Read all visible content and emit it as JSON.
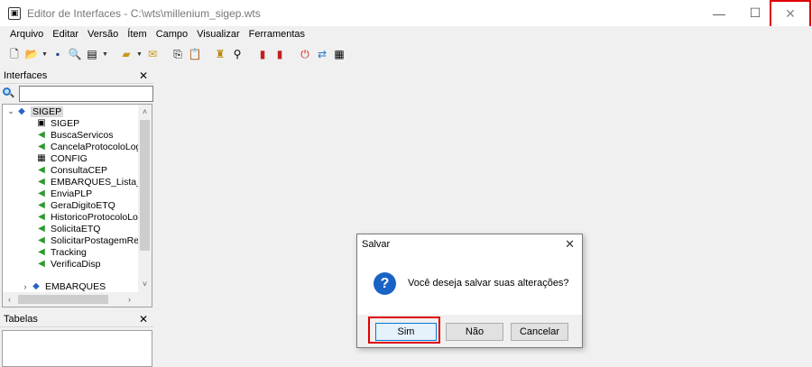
{
  "window": {
    "title": "Editor de Interfaces - C:\\wts\\millenium_sigep.wts",
    "app_icon": "form-window-icon",
    "minimize_icon": "—",
    "maximize_icon": "☐",
    "close_icon": "✕"
  },
  "menubar": [
    "Arquivo",
    "Editar",
    "Versão",
    "Ítem",
    "Campo",
    "Visualizar",
    "Ferramentas"
  ],
  "toolbar": {
    "icons": [
      "new-file-icon",
      "open-folder-icon",
      "save-icon",
      "find-icon",
      "preview-icon",
      "new-interface-icon",
      "open-interface-icon",
      "copy-icon",
      "paste-icon",
      "build-icon",
      "pin-icon",
      "add-field-icon",
      "remove-field-icon",
      "stop-icon",
      "compare-icon",
      "table-icon"
    ]
  },
  "interfaces_pane": {
    "header": "Interfaces",
    "close": "✕",
    "search": {
      "value": "",
      "placeholder": ""
    },
    "tree": {
      "root": "SIGEP",
      "children": [
        {
          "label": "SIGEP",
          "icon": "form-icon"
        },
        {
          "label": "BuscaServicos",
          "icon": "green-arrow-icon"
        },
        {
          "label": "CancelaProtocoloLogis",
          "icon": "green-arrow-icon"
        },
        {
          "label": "CONFIG",
          "icon": "calendar-icon"
        },
        {
          "label": "ConsultaCEP",
          "icon": "green-arrow-icon"
        },
        {
          "label": "EMBARQUES_Lista_Sig",
          "icon": "green-arrow-icon"
        },
        {
          "label": "EnviaPLP",
          "icon": "green-arrow-icon"
        },
        {
          "label": "GeraDigitoETQ",
          "icon": "green-arrow-icon"
        },
        {
          "label": "HistoricoProtocoloLogis",
          "icon": "green-arrow-icon"
        },
        {
          "label": "SolicitaETQ",
          "icon": "green-arrow-icon"
        },
        {
          "label": "SolicitarPostagemReve",
          "icon": "green-arrow-icon"
        },
        {
          "label": "Tracking",
          "icon": "green-arrow-icon"
        },
        {
          "label": "VerificaDisp",
          "icon": "green-arrow-icon"
        }
      ],
      "sibling": "EMBARQUES"
    }
  },
  "tabelas_pane": {
    "header": "Tabelas",
    "close": "✕"
  },
  "dialog": {
    "title": "Salvar",
    "close": "✕",
    "icon": "question-icon",
    "icon_glyph": "?",
    "message": "Você deseja salvar suas alterações?",
    "buttons": {
      "yes": "Sim",
      "no": "Não",
      "cancel": "Cancelar"
    }
  },
  "colors": {
    "highlight": "#e00000",
    "accent": "#0078d7",
    "question_icon": "#1a63c6"
  }
}
